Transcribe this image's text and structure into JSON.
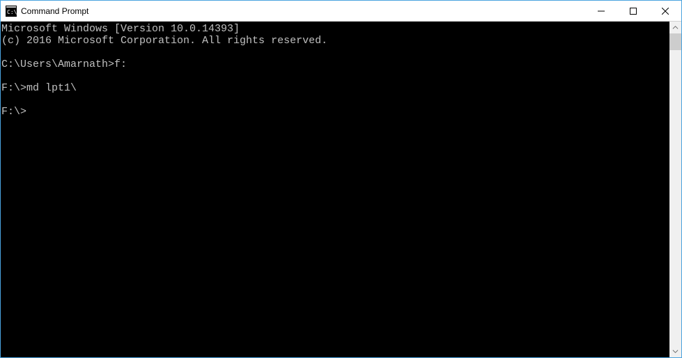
{
  "window": {
    "title": "Command Prompt"
  },
  "terminal": {
    "lines": [
      "Microsoft Windows [Version 10.0.14393]",
      "(c) 2016 Microsoft Corporation. All rights reserved.",
      "",
      "C:\\Users\\Amarnath>f:",
      "",
      "F:\\>md lpt1\\",
      "",
      "F:\\>"
    ]
  }
}
